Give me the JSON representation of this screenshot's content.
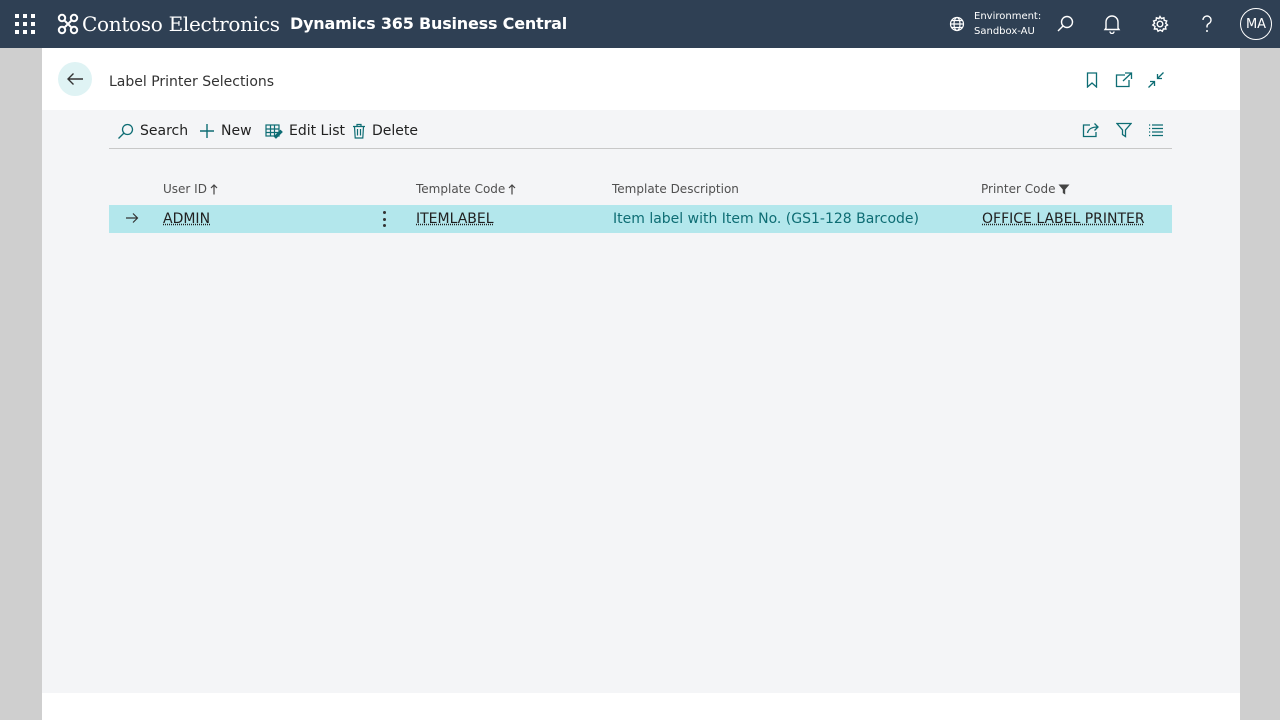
{
  "app": {
    "company_name": "Contoso Electronics",
    "product_name": "Dynamics 365 Business Central",
    "environment_label": "Environment:",
    "environment_value": "Sandbox-AU",
    "user_initials": "MA"
  },
  "page": {
    "title": "Label Printer Selections"
  },
  "actions": {
    "search": "Search",
    "new": "New",
    "edit_list": "Edit List",
    "delete": "Delete"
  },
  "table": {
    "columns": {
      "user_id": "User ID",
      "template_code": "Template Code",
      "template_description": "Template Description",
      "printer_code": "Printer Code"
    },
    "rows": [
      {
        "user_id": "ADMIN",
        "template_code": "ITEMLABEL",
        "template_description": "Item label with Item No. (GS1-128 Barcode)",
        "printer_code": "OFFICE LABEL PRINTER"
      }
    ]
  },
  "colors": {
    "topbar": "#2f4054",
    "accent": "#0e6d74",
    "selected_row": "#b3e7ec"
  },
  "icons": [
    "waffle-icon",
    "contoso-logo-icon",
    "globe-icon",
    "search-icon",
    "bell-icon",
    "gear-icon",
    "help-icon",
    "back-arrow-icon",
    "bookmark-icon",
    "open-new-window-icon",
    "collapse-icon",
    "plus-icon",
    "edit-list-icon",
    "trash-icon",
    "share-icon",
    "filter-icon",
    "list-view-icon",
    "row-arrow-icon",
    "more-options-icon",
    "sort-ascending-icon",
    "filter-applied-icon"
  ]
}
